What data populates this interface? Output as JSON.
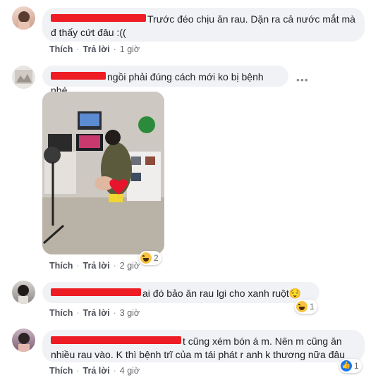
{
  "labels": {
    "like": "Thích",
    "reply": "Trả lời",
    "sep": "·"
  },
  "comments": [
    {
      "text": "Trước đéo chịu ăn rau. Dặn ra cả nước mắt mà đ thấy cứt đâu :((",
      "time": "1 giờ"
    },
    {
      "text": "ngồi phải đúng cách mới ko bị bệnh nhé",
      "time": "2 giờ",
      "reaction_count": "2",
      "reaction_icon": "haha-icon",
      "more": "•••"
    },
    {
      "text": "ai đó bảo ăn rau lgi cho xanh ruột😌",
      "time": "3 giờ",
      "reaction_count": "1",
      "reaction_icon": "haha-icon"
    },
    {
      "text": "t cũng xém bón á m. Nên m cũng ăn nhiều rau vào. K thì bệnh trĩ của m tái phát r anh k thương nữa đâu",
      "time": "4 giờ",
      "reaction_count": "1",
      "reaction_icon": "like-icon"
    }
  ]
}
